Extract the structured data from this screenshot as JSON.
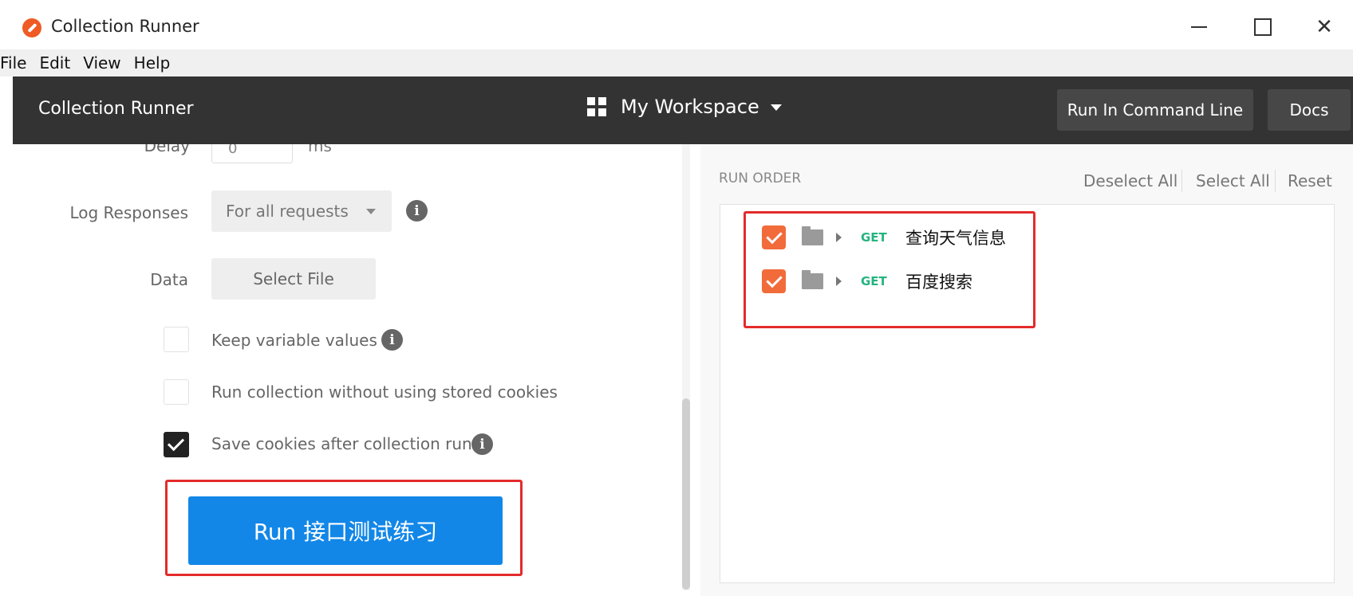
{
  "window": {
    "title": "Collection Runner",
    "min_icon": "minimize-icon",
    "max_icon": "maximize-icon",
    "close_label": "✕"
  },
  "menu": {
    "items": [
      "File",
      "Edit",
      "View",
      "Help"
    ]
  },
  "header": {
    "title": "Collection Runner",
    "workspace": "My Workspace",
    "run_cmd_label": "Run In Command Line",
    "docs_label": "Docs"
  },
  "left": {
    "delay_label": "Delay",
    "delay_value": "0",
    "ms_label": "ms",
    "log_label": "Log Responses",
    "log_value": "For all requests",
    "data_label": "Data",
    "select_file_label": "Select File",
    "keep_vars_label": "Keep variable values",
    "no_cookies_label": "Run collection without using stored cookies",
    "save_cookies_label": "Save cookies after collection run",
    "run_label": "Run 接口测试练习"
  },
  "right": {
    "run_order_label": "RUN ORDER",
    "deselect_all": "Deselect All",
    "select_all": "Select All",
    "reset": "Reset",
    "requests": [
      {
        "method": "GET",
        "name": "查询天气信息",
        "checked": true
      },
      {
        "method": "GET",
        "name": "百度搜索",
        "checked": true
      }
    ]
  },
  "colors": {
    "header_bg": "#333333",
    "run_button": "#1287e8",
    "checkbox_orange": "#f26b3a",
    "get_method": "#26b47f",
    "highlight_red": "#e32b2b"
  }
}
